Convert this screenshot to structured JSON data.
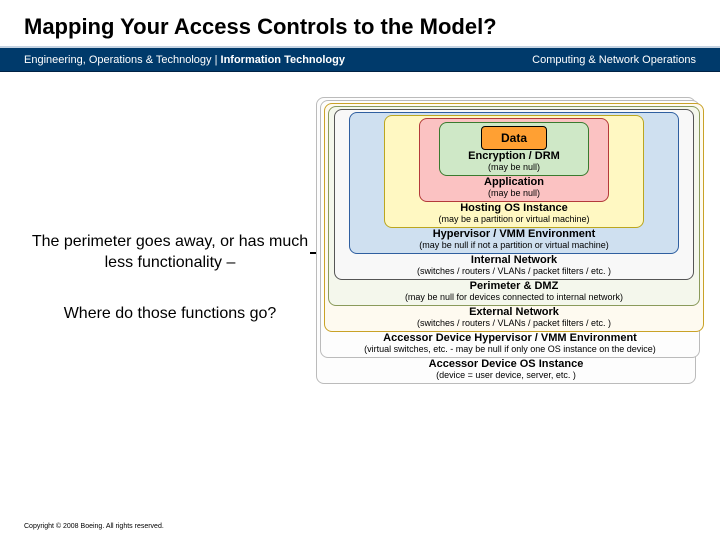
{
  "title": "Mapping Your Access Controls to the Model?",
  "band": {
    "left_plain": "Engineering, Operations & Technology | ",
    "left_bold": "Information Technology",
    "right": "Computing & Network Operations"
  },
  "body": {
    "p1": "The perimeter goes away, or has much less functionality –",
    "p2": "Where do those functions go?"
  },
  "layers": {
    "data": "Data",
    "enc_lbl": "Encryption / DRM",
    "enc_sub": "(may be null)",
    "app_lbl": "Application",
    "app_sub": "(may be null)",
    "host_lbl": "Hosting OS Instance",
    "host_sub": "(may be a partition or virtual machine)",
    "hyp_lbl": "Hypervisor / VMM Environment",
    "hyp_sub": "(may be null if not a partition or virtual machine)",
    "int_lbl": "Internal Network",
    "int_sub": "(switches / routers / VLANs / packet filters / etc. )",
    "per_lbl": "Perimeter & DMZ",
    "per_sub": "(may be null for devices connected to internal network)",
    "ext_lbl": "External Network",
    "ext_sub": "(switches / routers / VLANs / packet filters / etc. )",
    "advm_lbl": "Accessor Device Hypervisor / VMM Environment",
    "advm_sub": "(virtual switches, etc. - may be null if only one OS instance on the device)",
    "ados_lbl": "Accessor Device OS Instance",
    "ados_sub": "(device = user device, server, etc. )"
  },
  "footer": "Copyright © 2008 Boeing. All rights reserved."
}
